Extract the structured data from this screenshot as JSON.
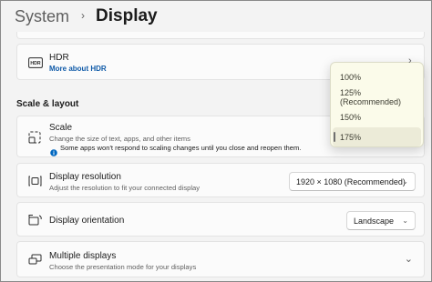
{
  "breadcrumb": {
    "parent": "System",
    "separator": "›",
    "current": "Display"
  },
  "hdr": {
    "title": "HDR",
    "link": "More about HDR",
    "icon": "hdr-icon",
    "chevron": "›"
  },
  "section": {
    "scale_layout": "Scale & layout"
  },
  "scale": {
    "title": "Scale",
    "subtitle": "Change the size of text, apps, and other items",
    "warning_icon": "info-icon",
    "warning": "Some apps won't respond to scaling changes until you close and reopen them.",
    "icon": "scale-icon"
  },
  "scale_flyout": {
    "options": [
      {
        "label": "100%"
      },
      {
        "label": "125% (Recommended)"
      },
      {
        "label": "150%"
      },
      {
        "label": "175%"
      }
    ],
    "selected": "175%"
  },
  "resolution": {
    "title": "Display resolution",
    "subtitle": "Adjust the resolution to fit your connected display",
    "value": "1920 × 1080 (Recommended)",
    "icon": "resolution-icon"
  },
  "orientation": {
    "title": "Display orientation",
    "value": "Landscape",
    "icon": "orientation-icon"
  },
  "multiple": {
    "title": "Multiple displays",
    "subtitle": "Choose the presentation mode for your displays",
    "icon": "multiple-displays-icon",
    "chevron": "⌄"
  },
  "colors": {
    "link": "#0f5aa8",
    "flyout_bg": "#fbfbea",
    "info_blue": "#0067c0"
  }
}
